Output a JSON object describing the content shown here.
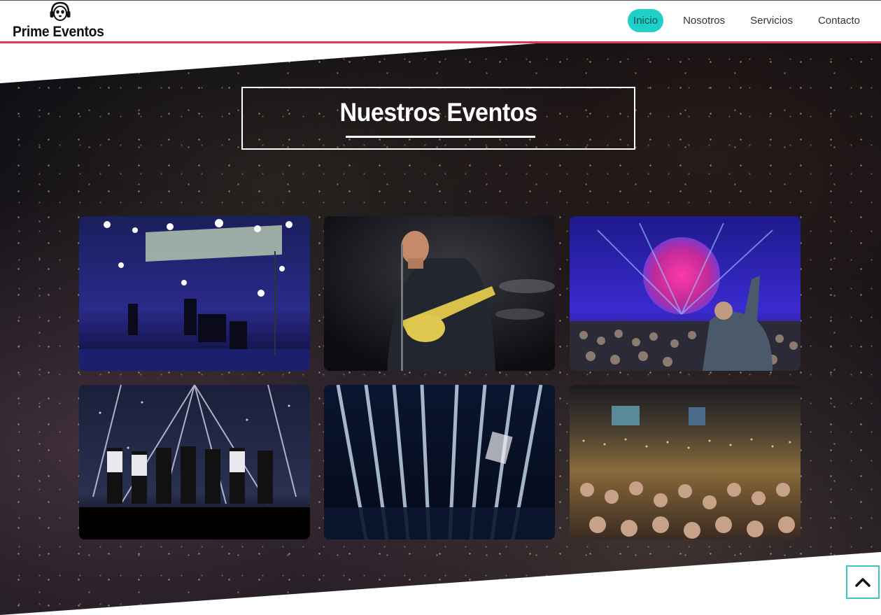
{
  "brand": {
    "name": "Prime Eventos",
    "logo_icon": "napster-cat-headphones-icon"
  },
  "nav": {
    "items": [
      {
        "label": "Inicio",
        "active": true
      },
      {
        "label": "Nosotros",
        "active": false
      },
      {
        "label": "Servicios",
        "active": false
      },
      {
        "label": "Contacto",
        "active": false
      }
    ]
  },
  "events": {
    "title": "Nuestros Eventos",
    "cards": [
      {
        "scene": "concert-stage-blue-lights"
      },
      {
        "scene": "guitarist-performance"
      },
      {
        "scene": "pink-floyd-stage-crowd"
      },
      {
        "scene": "group-bow-on-stage"
      },
      {
        "scene": "light-beams-stage"
      },
      {
        "scene": "stadium-crowd-night"
      }
    ]
  },
  "scroll_top": {
    "icon": "chevron-up-icon"
  },
  "colors": {
    "accent": "#1fd0c8",
    "brand_line": "#e8335e",
    "scroll_border": "#3ac6c6"
  }
}
